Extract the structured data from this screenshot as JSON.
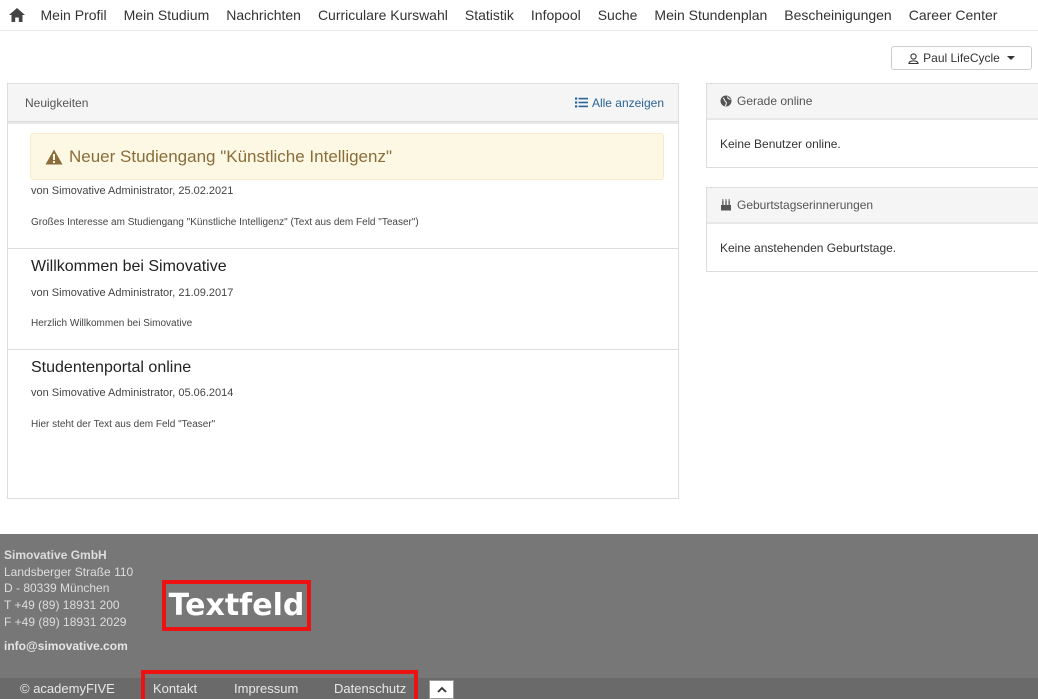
{
  "nav": {
    "home_icon": "home-icon",
    "items": [
      "Mein Profil",
      "Mein Studium",
      "Nachrichten",
      "Curriculare Kurswahl",
      "Statistik",
      "Infopool",
      "Suche",
      "Mein Stundenplan",
      "Bescheinigungen",
      "Career Center"
    ]
  },
  "user": {
    "name": "Paul LifeCycle",
    "icon": "user-icon"
  },
  "news": {
    "title": "Neuigkeiten",
    "show_all": "Alle anzeigen",
    "items": [
      {
        "title": "Neuer Studiengang \"Künstliche Intelligenz\"",
        "meta": "von Simovative Administrator, 25.02.2021",
        "teaser": "Großes Interesse am Studiengang \"Künstliche Intelligenz\" (Text aus dem Feld \"Teaser\")",
        "highlight": true
      },
      {
        "title": "Willkommen bei Simovative",
        "meta": "von Simovative Administrator, 21.09.2017",
        "teaser": "Herzlich Willkommen bei Simovative"
      },
      {
        "title": "Studentenportal online",
        "meta": "von Simovative Administrator, 05.06.2014",
        "teaser": "Hier steht der Text aus dem Feld \"Teaser\""
      }
    ]
  },
  "online": {
    "title": "Gerade online",
    "body": "Keine Benutzer online."
  },
  "birthdays": {
    "title": "Geburtstagserinnerungen",
    "body": "Keine anstehenden Geburtstage."
  },
  "footer": {
    "company": "Simovative GmbH",
    "street": "Landsberger Straße 110",
    "city": "D - 80339 München",
    "phone": "T +49 (89) 18931 200",
    "fax": "F +49 (89) 18931 2029",
    "email": "info@simovative.com",
    "annotation": "Textfeld",
    "copyright": "© academyFIVE",
    "links": [
      "Kontakt",
      "Impressum",
      "Datenschutz"
    ]
  },
  "colors": {
    "annotation_border": "#ee1111",
    "alert_bg": "#fcf8e3",
    "alert_text": "#8a6d3b",
    "link": "#2a6496",
    "footer_bg": "#777777"
  }
}
